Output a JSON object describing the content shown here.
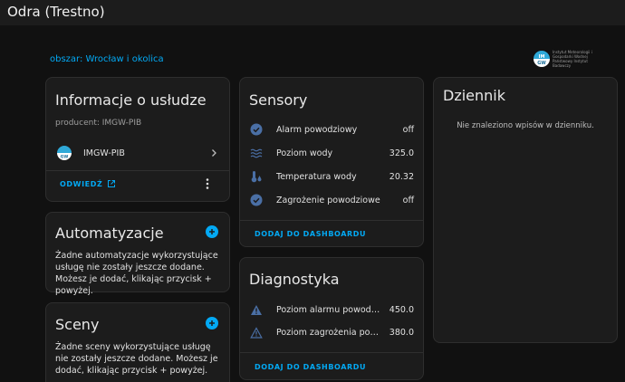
{
  "app": {
    "title": "Odra (Trestno)"
  },
  "area": {
    "link": "obszar: Wrocław i okolica"
  },
  "brand": {
    "logo_text": "IMGW",
    "lettering": "Instytut Meteorologii i Gospodarki Wodnej Państwowy Instytut Badawczy"
  },
  "info": {
    "title": "Informacje o usłudze",
    "producer": "producent: IMGW-PIB",
    "integration": "IMGW-PIB",
    "visit": "ODWIEDŹ"
  },
  "automations": {
    "title": "Automatyzacje",
    "text": "Żadne automatyzacje wykorzystujące usługę nie zostały jeszcze dodane. Możesz je dodać, klikając przycisk + powyżej."
  },
  "scenes": {
    "title": "Sceny",
    "text": "Żadne sceny wykorzystujące usługę nie zostały jeszcze dodane. Możesz je dodać, klikając przycisk + powyżej."
  },
  "sensors": {
    "title": "Sensory",
    "items": [
      {
        "label": "Alarm powodziowy",
        "value": "off",
        "icon": "check-circle-icon"
      },
      {
        "label": "Poziom wody",
        "value": "325.0",
        "icon": "waves-icon"
      },
      {
        "label": "Temperatura wody",
        "value": "20.32",
        "icon": "thermometer-water-icon"
      },
      {
        "label": "Zagrożenie powodziowe",
        "value": "off",
        "icon": "check-circle-icon"
      }
    ],
    "action": "DODAJ DO DASHBOARDU"
  },
  "diagnostics": {
    "title": "Diagnostyka",
    "items": [
      {
        "label": "Poziom alarmu powodziowego",
        "value": "450.0",
        "icon": "alert-icon"
      },
      {
        "label": "Poziom zagrożenia powodziowego",
        "value": "380.0",
        "icon": "alert-outline-icon"
      }
    ],
    "action": "DODAJ DO DASHBOARDU"
  },
  "logbook": {
    "title": "Dziennik",
    "empty": "Nie znaleziono wpisów w dzienniku."
  },
  "colors": {
    "accent": "#03a9f4",
    "icon": "#4a6fa5",
    "card": "#1c1c1c",
    "background": "#111111"
  }
}
